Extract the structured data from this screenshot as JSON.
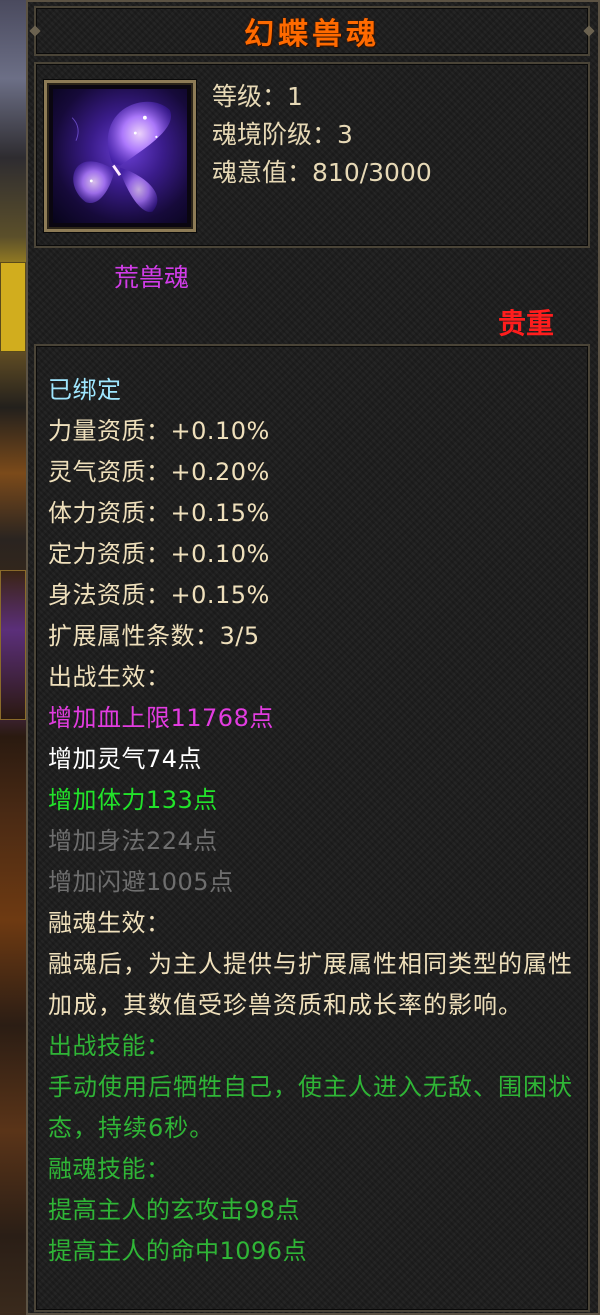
{
  "title": "幻蝶兽魂",
  "item_icon": "purple-butterfly-icon",
  "stats": [
    {
      "label": "等级：",
      "value": "1"
    },
    {
      "label": "魂境阶级：",
      "value": "3"
    },
    {
      "label": "魂意值：",
      "value": "810/3000"
    }
  ],
  "soul_type": "荒兽魂",
  "rarity": "贵重",
  "bound": "已绑定",
  "aptitudes": [
    "力量资质：+0.10%",
    "灵气资质：+0.20%",
    "体力资质：+0.15%",
    "定力资质：+0.10%",
    "身法资质：+0.15%"
  ],
  "ext_count": "扩展属性条数：3/5",
  "battle_effect_header": "出战生效：",
  "battle_effects": [
    {
      "text": "增加血上限11768点",
      "color": "#e23ce0"
    },
    {
      "text": "增加灵气74点",
      "color": "#ffffff"
    },
    {
      "text": "增加体力133点",
      "color": "#22e32a"
    },
    {
      "text": "增加身法224点",
      "color": "#6e6e6e"
    },
    {
      "text": "增加闪避1005点",
      "color": "#6e6e6e"
    }
  ],
  "fusion_effect_header": "融魂生效：",
  "fusion_effect_desc": "融魂后，为主人提供与扩展属性相同类型的属性加成，其数值受珍兽资质和成长率的影响。",
  "battle_skill_header": "出战技能：",
  "battle_skill_desc": "手动使用后牺牲自己，使主人进入无敌、围困状态，持续6秒。",
  "fusion_skill_header": "融魂技能：",
  "fusion_skills": [
    "提高主人的玄攻击98点",
    "提高主人的命中1096点"
  ]
}
